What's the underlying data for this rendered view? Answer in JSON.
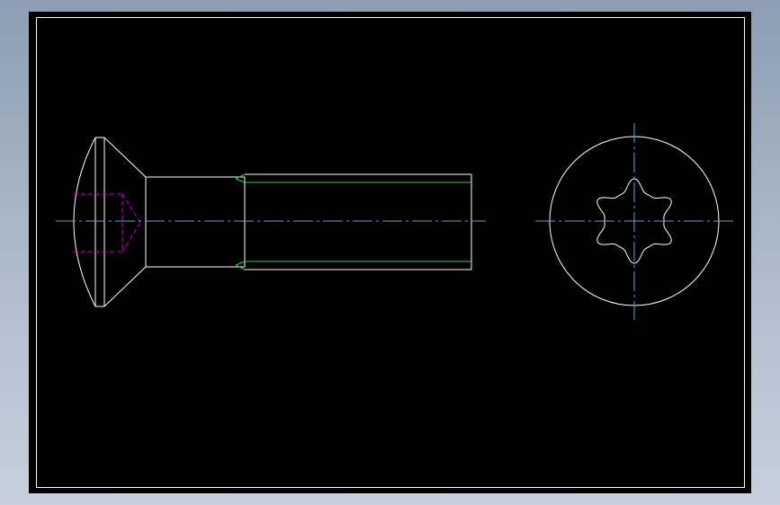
{
  "viewport": {
    "background": "#000000",
    "border_color": "#ffffff"
  },
  "colors": {
    "outline": "#ffffff",
    "thread": "#33cc33",
    "hidden": "#d000d0",
    "centerline": "#5aa9c8"
  },
  "views": [
    {
      "name": "side-view",
      "parts": [
        "head",
        "shank",
        "threaded-section",
        "hidden-recess",
        "centerline"
      ]
    },
    {
      "name": "end-view",
      "parts": [
        "head-circle",
        "torx-recess",
        "centerline-horizontal",
        "centerline-vertical"
      ]
    }
  ]
}
